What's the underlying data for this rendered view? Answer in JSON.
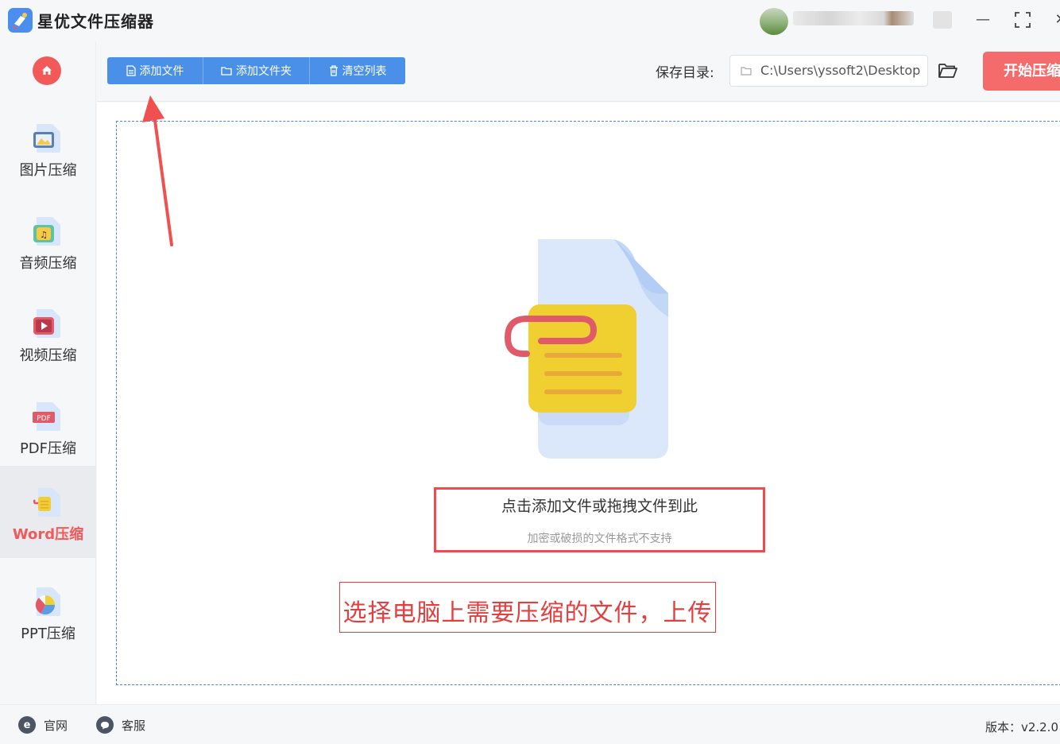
{
  "app": {
    "title": "星优文件压缩器"
  },
  "window": {
    "minimize": "—",
    "maximize": "⛶",
    "close": "✕"
  },
  "sidebar": {
    "items": [
      {
        "label": "图片压缩",
        "icon": "image-file-icon"
      },
      {
        "label": "音频压缩",
        "icon": "audio-file-icon"
      },
      {
        "label": "视频压缩",
        "icon": "video-file-icon"
      },
      {
        "label": "PDF压缩",
        "icon": "pdf-file-icon",
        "badge": "PDF"
      },
      {
        "label": "Word压缩",
        "icon": "word-file-icon",
        "active": true
      },
      {
        "label": "PPT压缩",
        "icon": "ppt-file-icon"
      }
    ]
  },
  "toolbar": {
    "add_file": "添加文件",
    "add_folder": "添加文件夹",
    "clear_list": "清空列表",
    "save_dir_label": "保存目录:",
    "save_dir_value": "C:\\Users\\yssoft2\\Desktop",
    "start": "开始压缩"
  },
  "dropzone": {
    "title": "点击添加文件或拖拽文件到此",
    "subtitle": "加密或破损的文件格式不支持"
  },
  "annotation": {
    "text": "选择电脑上需要压缩的文件，上传"
  },
  "statusbar": {
    "website": "官网",
    "website_icon_glyph": "e",
    "support": "客服",
    "version": "版本：v2.2.0"
  },
  "colors": {
    "accent_blue": "#4a90e8",
    "accent_red": "#f56a6a",
    "annotation_red": "#e53e3e",
    "dropzone_border": "#4a86d8"
  }
}
